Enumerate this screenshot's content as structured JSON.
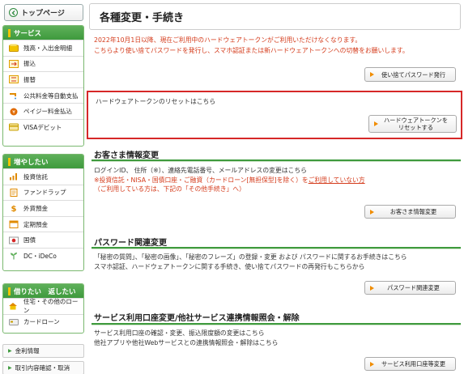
{
  "sidebar": {
    "top_button": "トップページ",
    "sections": [
      {
        "title": "サービス",
        "items": [
          "残高・入出金明細",
          "振込",
          "振替",
          "公共料金等自動支払",
          "ペイジー料金払込",
          "VISAデビット"
        ]
      },
      {
        "title": "増やしたい",
        "items": [
          "投資信託",
          "ファンドラップ",
          "外貨預金",
          "定期預金",
          "国債",
          "DC・iDeCo"
        ]
      },
      {
        "title": "借りたい　返したい",
        "items": [
          "住宅・その他のローン",
          "カードローン"
        ]
      }
    ],
    "links": [
      "金利情報",
      "取引内容確認・取消"
    ]
  },
  "main": {
    "page_title": "各種変更・手続き",
    "notice_line1": "2022年10月1日以降、現在ご利用中のハードウェアトークンがご利用いただけなくなります。",
    "notice_line2": "こちらより使い捨てパスワードを発行し、スマホ認証または新ハードウェアトークンへの切替をお願いします。",
    "disposable_pw_button": "使い捨てパスワード発行",
    "hw_text": "ハードウェアトークンのリセットはこちら",
    "hw_button_line1": "ハードウェアトークンを",
    "hw_button_line2": "リセットする",
    "customer": {
      "title": "お客さま情報変更",
      "line1": "ログインID、 住所（※）、連絡先電話番号、メールアドレスの変更はこちら",
      "line2_a": "※投資信託・NISA・国債口座・ご融資（カードローン[無担保型]を除く）を",
      "line2_b": "ご利用していない方",
      "line3": "（ご利用している方は、下記の「その他手続き」へ）",
      "button": "お客さま情報変更"
    },
    "password": {
      "title": "パスワード関連変更",
      "line1": "「秘密の質問」、「秘密の画像」、「秘密のフレーズ」の登録・変更 および パスワードに関するお手続きはこちら",
      "line2": "スマホ認証、ハードウェアトークンに関する手続き、使い捨てパスワードの再発行もこちらから",
      "button": "パスワード関連変更"
    },
    "service": {
      "title": "サービス利用口座変更/他社サービス連携情報照会・解除",
      "line1": "サービス利用口座の確認・変更、振込限度額の変更はこちら",
      "line2": "他社アプリや他社Webサービスとの連携情報照会・解除はこちら",
      "button": "サービス利用口座等変更"
    }
  }
}
